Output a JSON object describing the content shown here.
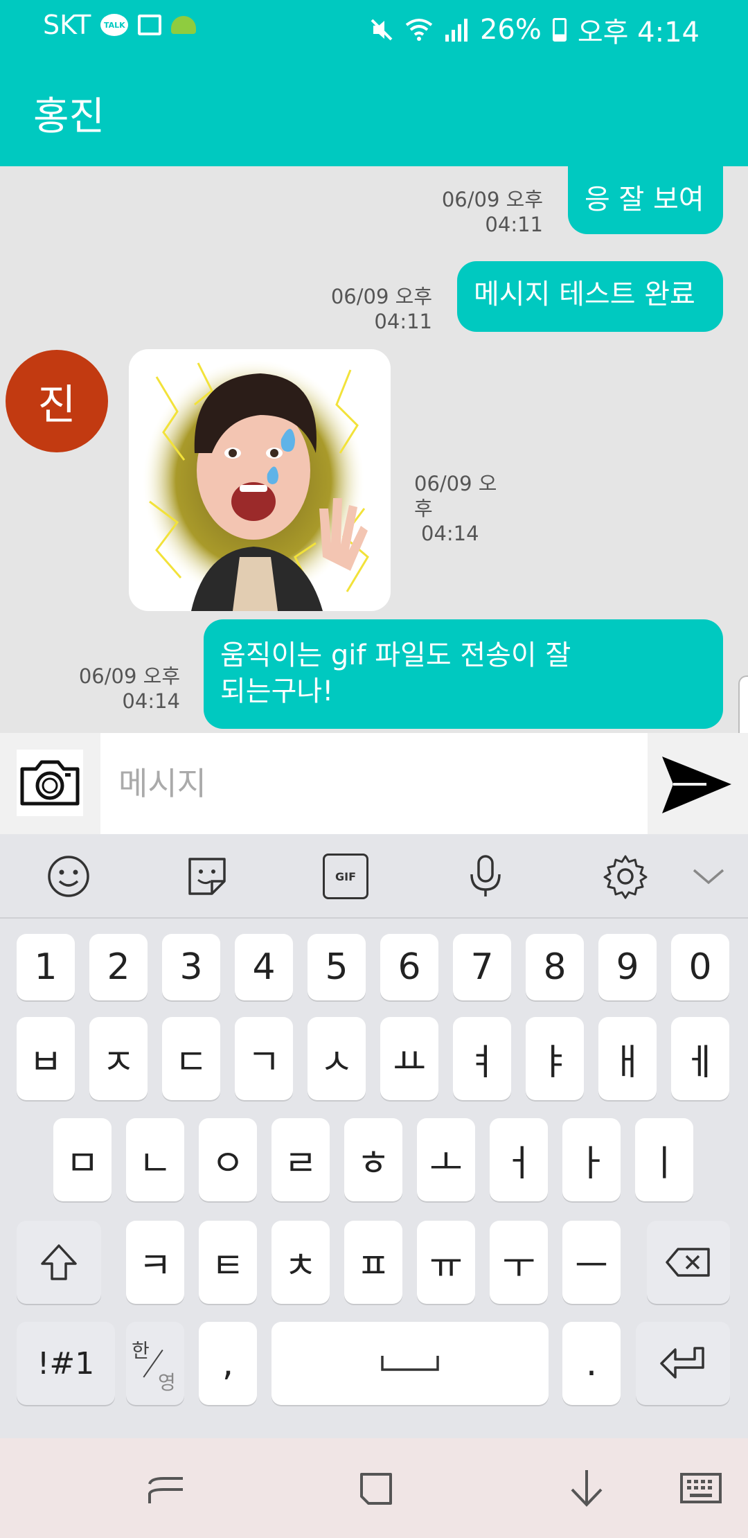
{
  "status_bar": {
    "carrier": "SKT",
    "talk_badge": "TALK",
    "battery": "26%",
    "time": "오후 4:14",
    "icons": [
      "kakaotalk-icon",
      "image-icon",
      "android-icon",
      "mute-icon",
      "wifi-icon",
      "signal-icon",
      "battery-icon"
    ]
  },
  "header": {
    "title": "홍진"
  },
  "messages": [
    {
      "side": "right",
      "text": "응 잘 보여",
      "date": "06/09 오후",
      "time": "04:11"
    },
    {
      "side": "right",
      "text": "메시지 테스트 완료",
      "date": "06/09 오후",
      "time": "04:11"
    },
    {
      "side": "left",
      "avatar_letter": "진",
      "type": "sticker",
      "date": "06/09 오후",
      "time": "04:14"
    },
    {
      "side": "right",
      "text_line1": "움직이는 gif 파일도 전송이 잘",
      "text_line2": "되는구나!",
      "date": "06/09 오후",
      "time": "04:14"
    }
  ],
  "input": {
    "placeholder": "메시지"
  },
  "keyboard": {
    "tools": [
      "emoji-icon",
      "sticker-icon",
      "gif-icon",
      "microphone-icon",
      "settings-icon",
      "chevron-down-icon"
    ],
    "gif_label": "GIF",
    "row1": [
      "1",
      "2",
      "3",
      "4",
      "5",
      "6",
      "7",
      "8",
      "9",
      "0"
    ],
    "row2": [
      "ㅂ",
      "ㅈ",
      "ㄷ",
      "ㄱ",
      "ㅅ",
      "ㅛ",
      "ㅕ",
      "ㅑ",
      "ㅐ",
      "ㅔ"
    ],
    "row3": [
      "ㅁ",
      "ㄴ",
      "ㅇ",
      "ㄹ",
      "ㅎ",
      "ㅗ",
      "ㅓ",
      "ㅏ",
      "ㅣ"
    ],
    "row4": [
      "ㅋ",
      "ㅌ",
      "ㅊ",
      "ㅍ",
      "ㅠ",
      "ㅜ",
      "ㅡ"
    ],
    "symbols_label": "!#1",
    "lang_top": "한",
    "lang_bottom": "영",
    "comma": ",",
    "period": "."
  },
  "colors": {
    "accent": "#00c9c0",
    "avatar": "#c23a11",
    "keyboard_bg": "#e4e5e9",
    "nav_bg": "#f0e5e5"
  }
}
